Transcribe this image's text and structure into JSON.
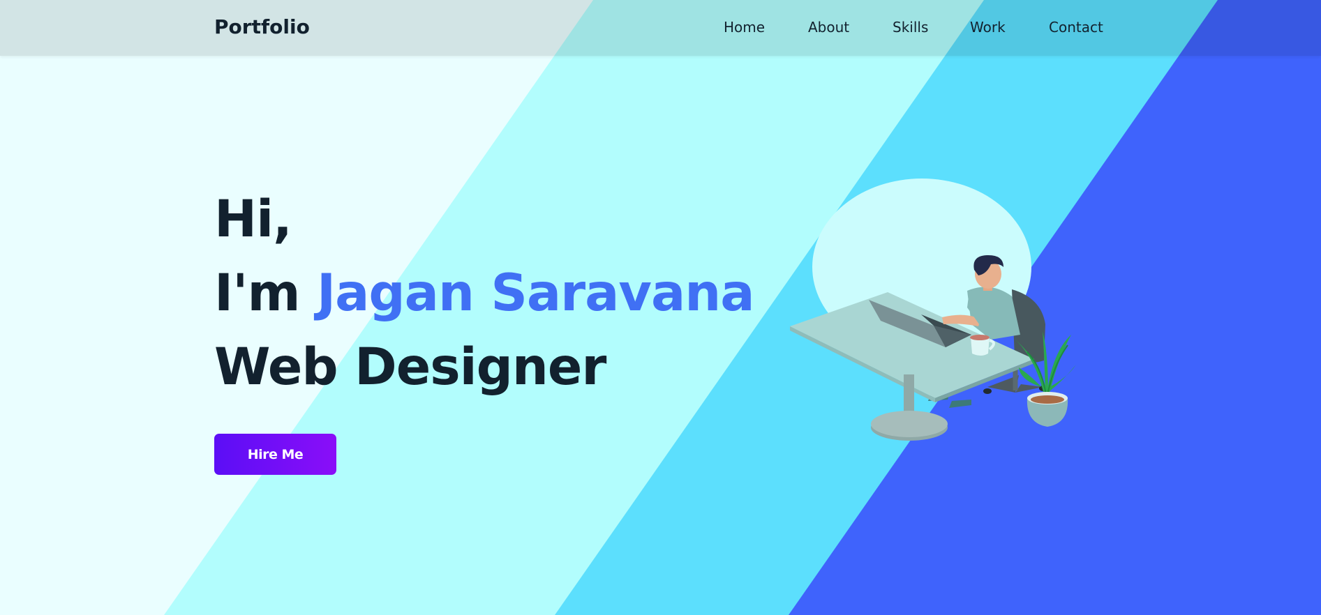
{
  "colors": {
    "text": "#12212e",
    "accent": "#4070f4",
    "band_light": "#eafeff",
    "band_cyan": "#b2fdfd",
    "band_sky": "#5cdffd",
    "band_blue": "#3f63fc",
    "button_gradient": [
      "#5b0ef6",
      "#8a0ef8"
    ]
  },
  "header": {
    "logo": "Portfolio",
    "nav": [
      "Home",
      "About",
      "Skills",
      "Work",
      "Contact"
    ]
  },
  "hero": {
    "greeting": "Hi,",
    "intro_prefix": "I'm ",
    "name": "Jagan Saravana",
    "role": "Web Designer",
    "cta": "Hire Me"
  },
  "illustration": {
    "icon": "person-working-at-laptop-desk-illustration"
  }
}
